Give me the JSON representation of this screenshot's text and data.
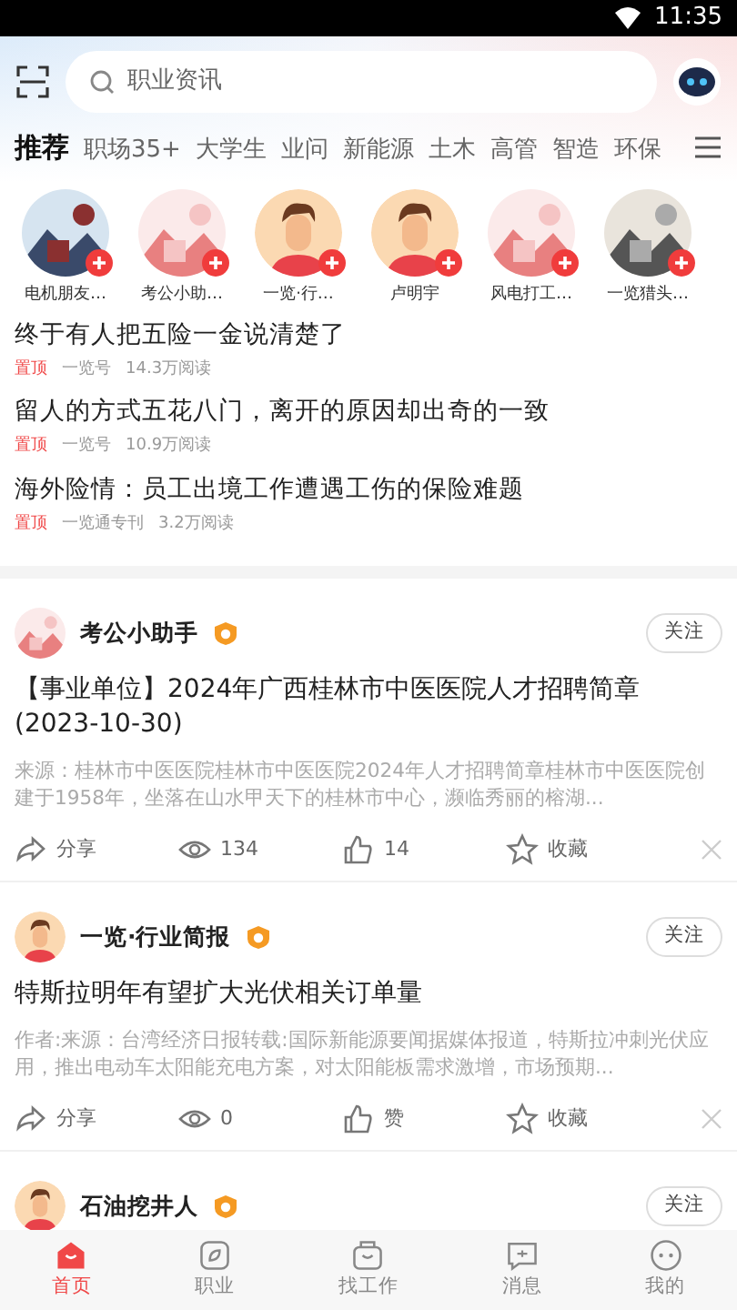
{
  "status_bar": {
    "time": "11:35"
  },
  "search": {
    "placeholder": "职业资讯"
  },
  "tabs": [
    {
      "label": "推荐",
      "selected": true
    },
    {
      "label": "职场35+",
      "selected": false
    },
    {
      "label": "大学生",
      "selected": false
    },
    {
      "label": "业问",
      "selected": false
    },
    {
      "label": "新能源",
      "selected": false
    },
    {
      "label": "土木",
      "selected": false
    },
    {
      "label": "高管",
      "selected": false
    },
    {
      "label": "智造",
      "selected": false
    },
    {
      "label": "环保",
      "selected": false
    }
  ],
  "followed_accounts": [
    {
      "name": "电机朋友…"
    },
    {
      "name": "考公小助…"
    },
    {
      "name": "一览·行…"
    },
    {
      "name": "卢明宇"
    },
    {
      "name": "风电打工…"
    },
    {
      "name": "一览猎头…"
    }
  ],
  "pinned_articles": [
    {
      "title": "终于有人把五险一金说清楚了",
      "tag": "置顶",
      "source": "一览号",
      "reads": "14.3万阅读"
    },
    {
      "title": "留人的方式五花八门，离开的原因却出奇的一致",
      "tag": "置顶",
      "source": "一览号",
      "reads": "10.9万阅读"
    },
    {
      "title": "海外险情：员工出境工作遭遇工伤的保险难题",
      "tag": "置顶",
      "source": "一览通专刊",
      "reads": "3.2万阅读"
    }
  ],
  "feed": [
    {
      "author": "考公小助手",
      "verified": true,
      "follow": "关注",
      "title": "【事业单位】2024年广西桂林市中医医院人才招聘简章(2023-10-30)",
      "summary": "来源：桂林市中医医院桂林市中医医院2024年人才招聘简章桂林市中医医院创建于1958年，坐落在山水甲天下的桂林市中心，濒临秀丽的榕湖...",
      "actions": [
        {
          "kind": "share",
          "label": "分享"
        },
        {
          "kind": "view",
          "label": "134"
        },
        {
          "kind": "like",
          "label": "14"
        },
        {
          "kind": "collect",
          "label": "收藏"
        }
      ]
    },
    {
      "author": "一览·行业简报",
      "verified": true,
      "follow": "关注",
      "title": "特斯拉明年有望扩大光伏相关订单量",
      "summary": "作者:来源：台湾经济日报转载:国际新能源要闻据媒体报道，特斯拉冲刺光伏应用，推出电动车太阳能充电方案，对太阳能板需求激增，市场预期...",
      "actions": [
        {
          "kind": "share",
          "label": "分享"
        },
        {
          "kind": "view",
          "label": "0"
        },
        {
          "kind": "like",
          "label": "赞"
        },
        {
          "kind": "collect",
          "label": "收藏"
        }
      ]
    },
    {
      "author": "石油挖井人",
      "verified": true,
      "follow": "关注"
    }
  ],
  "bottom_nav": [
    {
      "label": "首页",
      "kind": "home",
      "selected": true
    },
    {
      "label": "职业",
      "kind": "career",
      "selected": false
    },
    {
      "label": "找工作",
      "kind": "jobs",
      "selected": false
    },
    {
      "label": "消息",
      "kind": "messages",
      "selected": false
    },
    {
      "label": "我的",
      "kind": "me",
      "selected": false
    }
  ]
}
